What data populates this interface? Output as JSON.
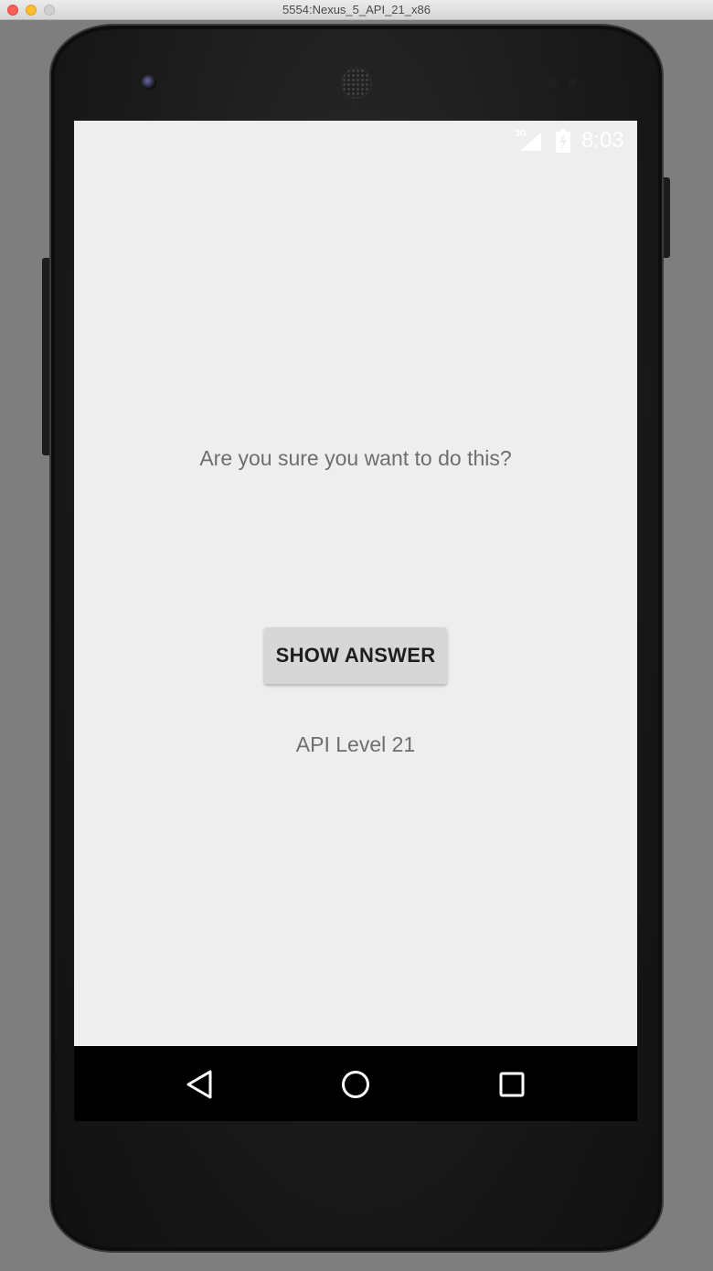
{
  "window": {
    "title": "5554:Nexus_5_API_21_x86"
  },
  "status_bar": {
    "network_type": "3G",
    "signal_icon": "cellular-signal-icon",
    "battery_icon": "battery-charging-icon",
    "time": "8:03"
  },
  "screen": {
    "question_text": "Are you sure you want to do this?",
    "show_answer_label": "SHOW ANSWER",
    "api_level_text": "API Level 21",
    "background_color": "#eeeeee"
  },
  "nav_bar": {
    "back_icon": "back-triangle-icon",
    "home_icon": "home-circle-icon",
    "recents_icon": "recents-square-icon"
  }
}
